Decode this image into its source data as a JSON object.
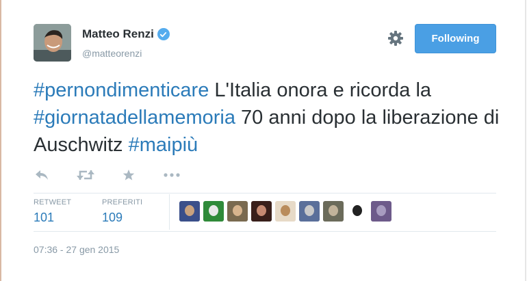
{
  "user": {
    "display_name": "Matteo Renzi",
    "handle": "@matteorenzi"
  },
  "actions": {
    "follow_label": "Following"
  },
  "tweet": {
    "segments": [
      {
        "text": "#pernondimenticare",
        "type": "hashtag"
      },
      {
        "text": " L'Italia onora e ricorda la ",
        "type": "text"
      },
      {
        "text": "#giornatadellamemoria",
        "type": "hashtag"
      },
      {
        "text": " 70 anni dopo la liberazione di Auschwitz ",
        "type": "text"
      },
      {
        "text": "#maipiù",
        "type": "hashtag"
      }
    ]
  },
  "stats": {
    "retweet_label": "RETWEET",
    "retweet_count": "101",
    "favorite_label": "PREFERITI",
    "favorite_count": "109"
  },
  "timestamp": "07:36 - 27 gen 2015",
  "icons": {
    "reply": "reply-icon",
    "retweet": "retweet-icon",
    "favorite": "star-icon",
    "more": "more-icon",
    "settings": "gear-icon",
    "verified": "verified-badge-icon"
  },
  "colors": {
    "hashtag": "#2b7bb9",
    "follow_button": "#4a9fe4",
    "muted": "#8899a6"
  },
  "faces": [
    {
      "colors": [
        "#3b4f8a",
        "#c9a27e"
      ]
    },
    {
      "colors": [
        "#2f8a3a",
        "#e8e8e8"
      ]
    },
    {
      "colors": [
        "#7a6a50",
        "#d7b48e"
      ]
    },
    {
      "colors": [
        "#3a1f1a",
        "#c68a72"
      ]
    },
    {
      "colors": [
        "#e7dac7",
        "#b98c5c"
      ]
    },
    {
      "colors": [
        "#5a6f9a",
        "#c9c9c9"
      ]
    },
    {
      "colors": [
        "#6b6b5a",
        "#c2b39a"
      ]
    },
    {
      "colors": [
        "#ffffff",
        "#222222"
      ]
    },
    {
      "colors": [
        "#6d5a8a",
        "#a89cc0"
      ]
    }
  ]
}
